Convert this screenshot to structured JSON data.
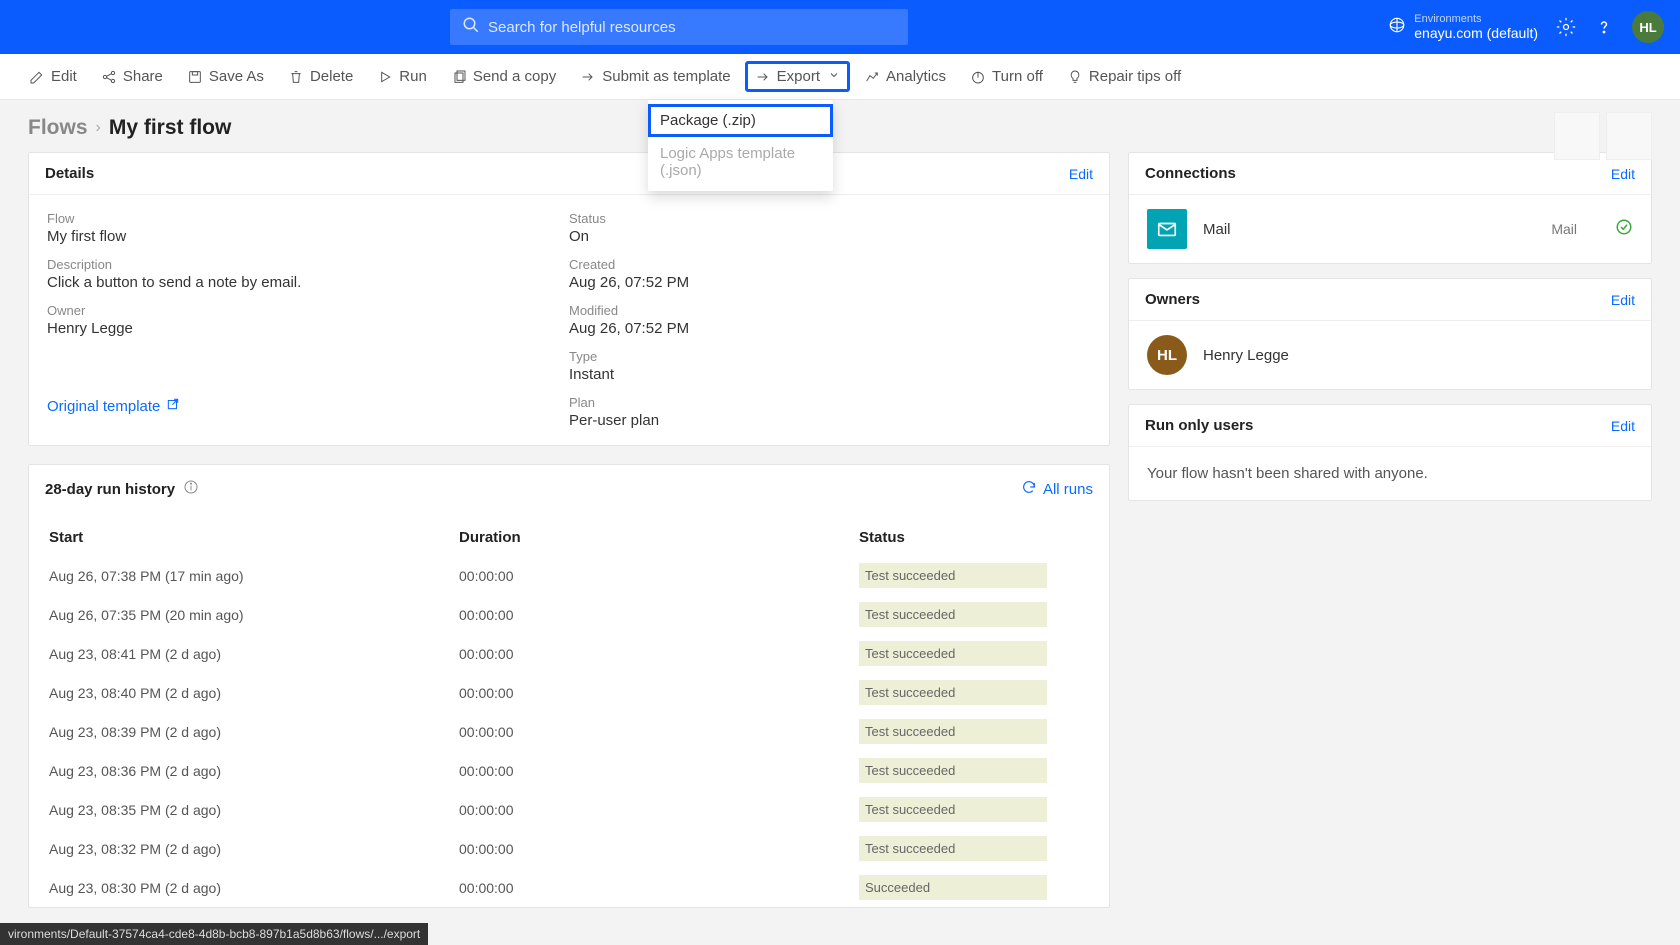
{
  "header": {
    "search_placeholder": "Search for helpful resources",
    "environment_label": "Environments",
    "environment_value": "enayu.com (default)",
    "avatar_initials": "HL"
  },
  "toolbar": {
    "edit": "Edit",
    "share": "Share",
    "save_as": "Save As",
    "delete": "Delete",
    "run": "Run",
    "send_copy": "Send a copy",
    "submit_template": "Submit as template",
    "export": "Export",
    "analytics": "Analytics",
    "turn_off": "Turn off",
    "repair_tips": "Repair tips off"
  },
  "export_menu": {
    "package": "Package (.zip)",
    "logic_apps": "Logic Apps template (.json)"
  },
  "breadcrumb": {
    "root": "Flows",
    "current": "My first flow"
  },
  "details": {
    "section_title": "Details",
    "edit": "Edit",
    "flow_label": "Flow",
    "flow_value": "My first flow",
    "description_label": "Description",
    "description_value": "Click a button to send a note by email.",
    "owner_label": "Owner",
    "owner_value": "Henry Legge",
    "status_label": "Status",
    "status_value": "On",
    "created_label": "Created",
    "created_value": "Aug 26, 07:52 PM",
    "modified_label": "Modified",
    "modified_value": "Aug 26, 07:52 PM",
    "type_label": "Type",
    "type_value": "Instant",
    "plan_label": "Plan",
    "plan_value": "Per-user plan",
    "template_link": "Original template"
  },
  "run_history": {
    "title": "28-day run history",
    "all_runs": "All runs",
    "col_start": "Start",
    "col_duration": "Duration",
    "col_status": "Status",
    "rows": [
      {
        "start": "Aug 26, 07:38 PM (17 min ago)",
        "duration": "00:00:00",
        "status": "Test succeeded"
      },
      {
        "start": "Aug 26, 07:35 PM (20 min ago)",
        "duration": "00:00:00",
        "status": "Test succeeded"
      },
      {
        "start": "Aug 23, 08:41 PM (2 d ago)",
        "duration": "00:00:00",
        "status": "Test succeeded"
      },
      {
        "start": "Aug 23, 08:40 PM (2 d ago)",
        "duration": "00:00:00",
        "status": "Test succeeded"
      },
      {
        "start": "Aug 23, 08:39 PM (2 d ago)",
        "duration": "00:00:00",
        "status": "Test succeeded"
      },
      {
        "start": "Aug 23, 08:36 PM (2 d ago)",
        "duration": "00:00:00",
        "status": "Test succeeded"
      },
      {
        "start": "Aug 23, 08:35 PM (2 d ago)",
        "duration": "00:00:00",
        "status": "Test succeeded"
      },
      {
        "start": "Aug 23, 08:32 PM (2 d ago)",
        "duration": "00:00:00",
        "status": "Test succeeded"
      },
      {
        "start": "Aug 23, 08:30 PM (2 d ago)",
        "duration": "00:00:00",
        "status": "Succeeded"
      }
    ]
  },
  "connections": {
    "title": "Connections",
    "edit": "Edit",
    "item_name": "Mail",
    "item_type": "Mail"
  },
  "owners": {
    "title": "Owners",
    "edit": "Edit",
    "avatar_initials": "HL",
    "name": "Henry Legge"
  },
  "run_only": {
    "title": "Run only users",
    "edit": "Edit",
    "body": "Your flow hasn't been shared with anyone."
  },
  "status_bar": "vironments/Default-37574ca4-cde8-4d8b-bcb8-897b1a5d8b63/flows/.../export"
}
